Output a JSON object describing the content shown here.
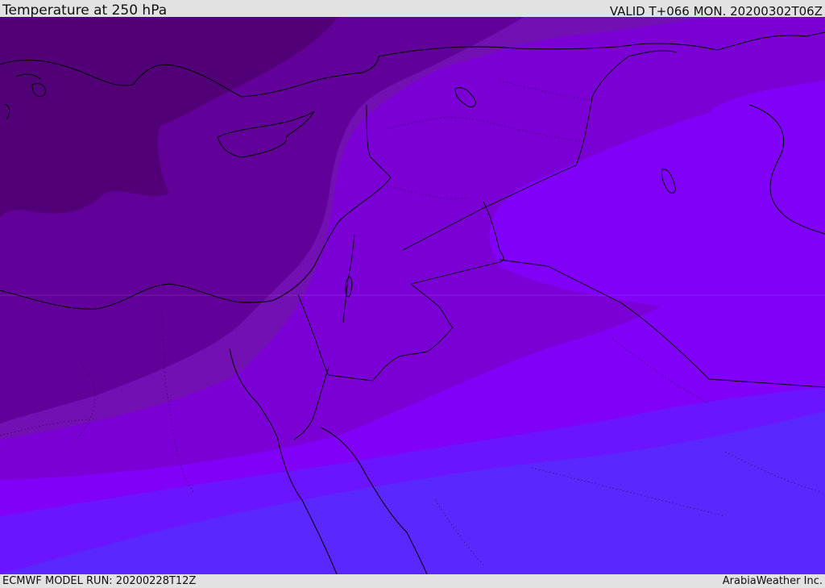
{
  "header": {
    "title": "Temperature at 250 hPa",
    "valid": "VALID T+066 MON. 20200302T06Z"
  },
  "footer": {
    "model_run": "ECMWF MODEL RUN: 20200228T12Z",
    "credit": "ArabiaWeather Inc."
  },
  "map": {
    "palette": {
      "band_1": "#520078",
      "band_2": "#62009a",
      "band_3": "#7310b4",
      "band_4": "#7b00d6",
      "band_5": "#8000f8",
      "band_6": "#6a14ff",
      "band_7": "#5a28ff",
      "coastline": "#000000",
      "border": "#3a0070"
    }
  }
}
